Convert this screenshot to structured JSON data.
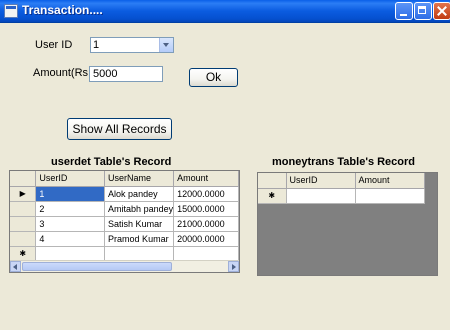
{
  "window": {
    "title": "Transaction...."
  },
  "form": {
    "userid_label": "User ID",
    "userid_value": "1",
    "amount_label": "Amount(Rs.)",
    "amount_value": "5000",
    "ok_label": "Ok",
    "show_all_label": "Show All Records"
  },
  "userdet": {
    "title": "userdet Table's Record",
    "columns": [
      "UserID",
      "UserName",
      "Amount"
    ],
    "rows": [
      {
        "UserID": "1",
        "UserName": "Alok pandey",
        "Amount": "12000.0000"
      },
      {
        "UserID": "2",
        "UserName": "Amitabh pandey",
        "Amount": "15000.0000"
      },
      {
        "UserID": "3",
        "UserName": "Satish Kumar",
        "Amount": "21000.0000"
      },
      {
        "UserID": "4",
        "UserName": "Pramod Kumar",
        "Amount": "20000.0000"
      }
    ],
    "current_row_marker": "▶",
    "new_row_marker": "✱"
  },
  "moneytrans": {
    "title": "moneytrans Table's Record",
    "columns": [
      "UserID",
      "Amount"
    ],
    "new_row_marker": "✱"
  },
  "icons": {
    "app": "window-app-icon",
    "minimize": "minimize-icon",
    "maximize": "maximize-icon",
    "close": "close-icon"
  },
  "colors": {
    "titlebar": "#0b5ce0",
    "background": "#ece9d8",
    "selection": "#316ac5",
    "empty_grid": "#808080"
  }
}
